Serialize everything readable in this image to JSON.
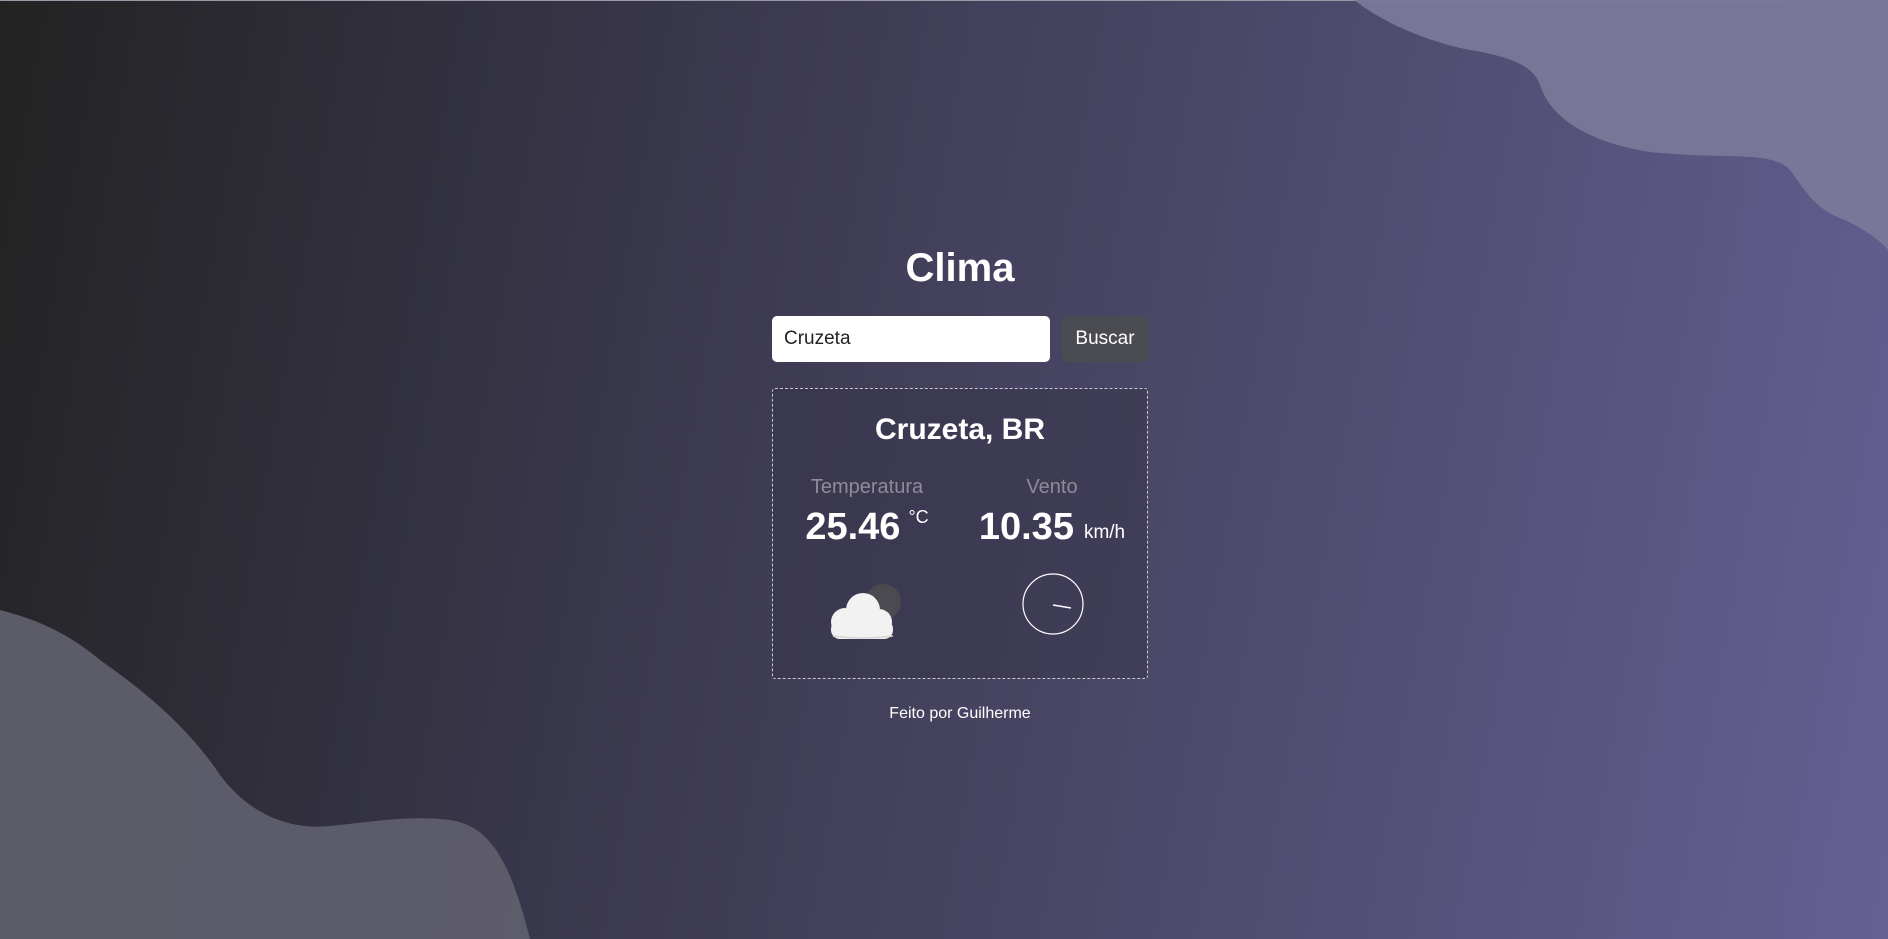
{
  "app": {
    "title": "Clima"
  },
  "search": {
    "value": "Cruzeta",
    "placeholder": "",
    "button_label": "Buscar"
  },
  "weather": {
    "location": "Cruzeta, BR",
    "temperature": {
      "label": "Temperatura",
      "value": "25.46",
      "unit": "°C"
    },
    "wind": {
      "label": "Vento",
      "value": "10.35",
      "unit": "km/h"
    },
    "condition_icon": "cloud-moon-icon",
    "wind_direction_icon": "wind-compass-icon"
  },
  "footer": {
    "text": "Feito por Guilherme"
  },
  "colors": {
    "background_start": "#232323",
    "background_end": "#646093",
    "button": "#4b4b52",
    "label": "#8e8c99"
  }
}
